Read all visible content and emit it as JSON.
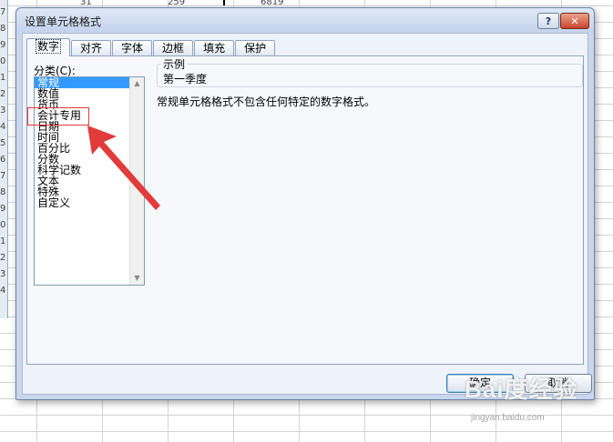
{
  "background": {
    "row_numbers": [
      "7",
      "8",
      "9",
      "0",
      "1",
      "2",
      "3",
      "4",
      "5",
      "6",
      "7",
      "8",
      "9",
      "0",
      "1",
      "2",
      "3",
      "4"
    ],
    "cell_fragments": [
      "31",
      "259",
      "6819"
    ]
  },
  "dialog": {
    "title": "设置单元格格式",
    "help_label": "?",
    "close_label": "✕",
    "tabs": [
      {
        "label": "数字",
        "active": true
      },
      {
        "label": "对齐",
        "active": false
      },
      {
        "label": "字体",
        "active": false
      },
      {
        "label": "边框",
        "active": false
      },
      {
        "label": "填充",
        "active": false
      },
      {
        "label": "保护",
        "active": false
      }
    ],
    "category_label": "分类(C):",
    "categories": [
      "常规",
      "数值",
      "货币",
      "会计专用",
      "日期",
      "时间",
      "百分比",
      "分数",
      "科学记数",
      "文本",
      "特殊",
      "自定义"
    ],
    "selected_category": "常规",
    "sample": {
      "legend": "示例",
      "value": "第一季度"
    },
    "description": "常规单元格格式不包含任何特定的数字格式。",
    "ok_label": "确定",
    "cancel_label": "取消"
  },
  "annotation": {
    "highlight_color": "#e23b3b",
    "arrow_color": "#e23b3b"
  },
  "watermark": {
    "text": "Bai度经验",
    "sub": "jingyan.baidu.com"
  },
  "colors": {
    "dialog_bg": "#c9d7ec",
    "selection": "#3399ff",
    "close_button": "#c8452a"
  }
}
